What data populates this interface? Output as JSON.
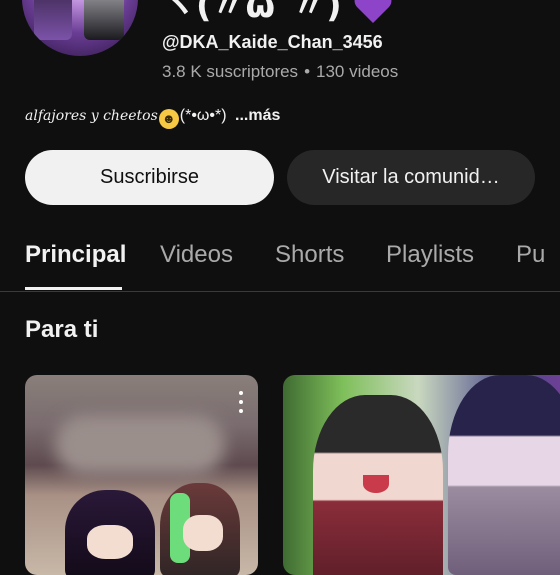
{
  "channel": {
    "name": "ヽ(〃ω´〃)",
    "handle": "@DKA_Kaide_Chan_3456",
    "subscribers": "3.8 K suscriptores",
    "separator": "•",
    "videos": "130 videos",
    "description_script": "alfajores y cheetos",
    "description_emoji": "☻",
    "description_face": "(*•ω•*)",
    "more_label": "...más",
    "heart_color": "#8e44c9"
  },
  "buttons": {
    "subscribe_label": "Suscribirse",
    "community_label": "Visitar la comunid…"
  },
  "tabs": [
    {
      "label": "Principal",
      "active": true
    },
    {
      "label": "Videos",
      "active": false
    },
    {
      "label": "Shorts",
      "active": false
    },
    {
      "label": "Playlists",
      "active": false
    },
    {
      "label": "Pu",
      "active": false
    }
  ],
  "section": {
    "title": "Para ti"
  },
  "cards": [
    {
      "menu_icon": "more-vertical-icon"
    },
    {}
  ]
}
